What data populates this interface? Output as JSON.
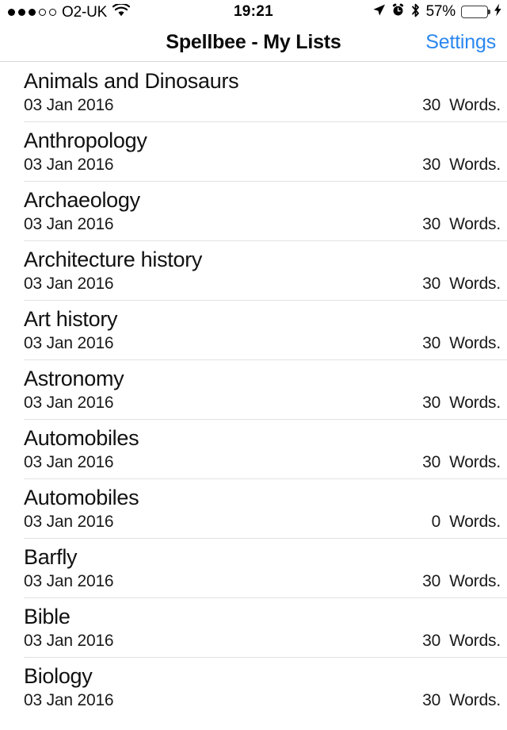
{
  "status_bar": {
    "signal_bars_filled": 3,
    "signal_bars_total": 5,
    "carrier": "O2-UK",
    "wifi_icon": "wifi-icon",
    "time": "19:21",
    "location_icon": "location-arrow-icon",
    "alarm_icon": "alarm-clock-icon",
    "bluetooth_icon": "bluetooth-icon",
    "battery_percent": "57%",
    "battery_level": 57,
    "battery_color": "#4CD562",
    "charging_icon": "lightning-bolt-icon"
  },
  "navbar": {
    "title": "Spellbee - My Lists",
    "action_label": "Settings",
    "action_color": "#2b87ef"
  },
  "list": {
    "word_label": "Words.",
    "rows": [
      {
        "title": "Animals and Dinosaurs",
        "date": "03 Jan 2016",
        "count": "30"
      },
      {
        "title": "Anthropology",
        "date": "03 Jan 2016",
        "count": "30"
      },
      {
        "title": "Archaeology",
        "date": "03 Jan 2016",
        "count": "30"
      },
      {
        "title": "Architecture history",
        "date": "03 Jan 2016",
        "count": "30"
      },
      {
        "title": "Art history",
        "date": "03 Jan 2016",
        "count": "30"
      },
      {
        "title": "Astronomy",
        "date": "03 Jan 2016",
        "count": "30"
      },
      {
        "title": "Automobiles",
        "date": "03 Jan 2016",
        "count": "30"
      },
      {
        "title": "Automobiles",
        "date": "03 Jan 2016",
        "count": "0"
      },
      {
        "title": "Barfly",
        "date": "03 Jan 2016",
        "count": "30"
      },
      {
        "title": "Bible",
        "date": "03 Jan 2016",
        "count": "30"
      },
      {
        "title": "Biology",
        "date": "03 Jan 2016",
        "count": "30"
      }
    ]
  }
}
